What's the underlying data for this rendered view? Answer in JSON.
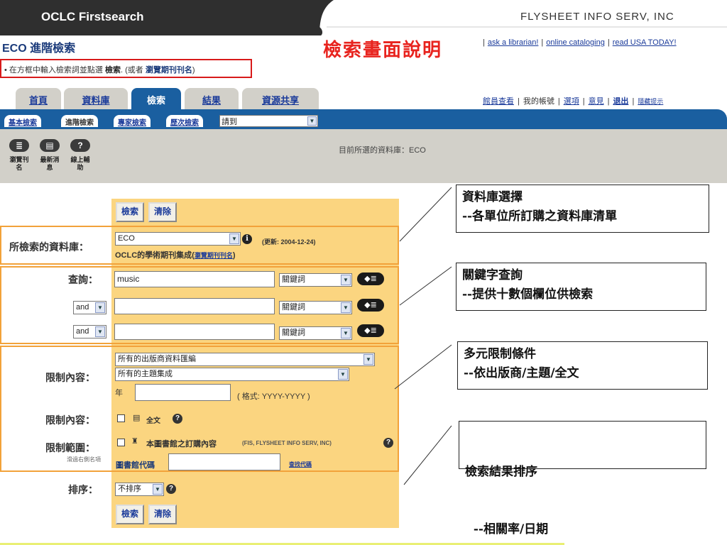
{
  "header": {
    "app_title": "OCLC Firstsearch",
    "company": "FLYSHEET INFO SERV, INC",
    "page_title": "ECO 進階檢索",
    "slide_title": "檢索畫面說明",
    "top_links": [
      "ask a librarian!",
      "online cataloging",
      "read USA TODAY!"
    ]
  },
  "hint": {
    "prefix": "在方框中輸入檢索詞並點選",
    "bold": "檢索",
    "middle": ". (或者",
    "link": "瀏覽期刊刊名",
    "suffix": ")"
  },
  "tabs": [
    "首頁",
    "資料庫",
    "檢索",
    "結果",
    "資源共享"
  ],
  "right_links": [
    "館員查看",
    "我的帳號",
    "選項",
    "意見",
    "退出",
    "隱藏提示"
  ],
  "subtabs": [
    "基本檢索",
    "進階檢索",
    "專家檢索",
    "歷次檢索"
  ],
  "nav_select": "請到",
  "toolbar": {
    "buttons": [
      {
        "icon": "browse-titles-icon",
        "label_1": "瀏覽刊",
        "label_2": "名"
      },
      {
        "icon": "news-icon",
        "label_1": "最新消",
        "label_2": "息"
      },
      {
        "icon": "help-icon",
        "label_1": "線上輔",
        "label_2": "助"
      }
    ],
    "current_db": "目前所選的資料庫：ECO"
  },
  "form": {
    "search_button": "檢索",
    "clear_button": "清除",
    "db_label": "所檢索的資料庫：",
    "db_value": "ECO",
    "db_updated": "(更新: 2004-12-24)",
    "db_desc": "OCLC的學術期刊集成",
    "db_desc_link": "瀏覽期刊刊名",
    "db_desc_suffix": ")",
    "db_desc_prefix": "(",
    "query_label": "查詢：",
    "query_rows": [
      {
        "op": "",
        "value": "music",
        "index": "關鍵詞"
      },
      {
        "op": "and",
        "value": "",
        "index": "關鍵詞"
      },
      {
        "op": "and",
        "value": "",
        "index": "關鍵詞"
      }
    ],
    "limit_label": "限制內容：",
    "publisher_select": "所有的出版商資料匯編",
    "subject_select": "所有的主題集成",
    "year_label": "年",
    "year_format": "( 格式: YYYY-YYYY )",
    "limit2_label": "限制內容：",
    "fulltext": "全文",
    "scope_label": "限制範圍：",
    "scope_sub": "滑過右側名項",
    "scope_text": "本圖書館之訂購內容",
    "scope_org": "(FIS, FLYSHEET INFO SERV, INC)",
    "library_code_label": "圖書館代碼",
    "find_code": "查找代碼",
    "sort_label": "排序：",
    "sort_value": "不排序"
  },
  "callouts": [
    {
      "line1": "資料庫選擇",
      "line2": "--各單位所訂購之資料庫清單"
    },
    {
      "line1": "關鍵字查詢",
      "line2": "--提供十數個欄位供檢索"
    },
    {
      "line1": "多元限制條件",
      "line2": "--依出版商/主題/全文"
    },
    {
      "line1": "檢索結果排序",
      "line2": "  --相關率/日期"
    }
  ],
  "colors": {
    "brand_blue": "#1a5fa0",
    "form_bg": "#fbd580",
    "highlight_border": "#f2a23a",
    "hint_border": "#d81a1a",
    "slide_title": "#e8231e"
  }
}
